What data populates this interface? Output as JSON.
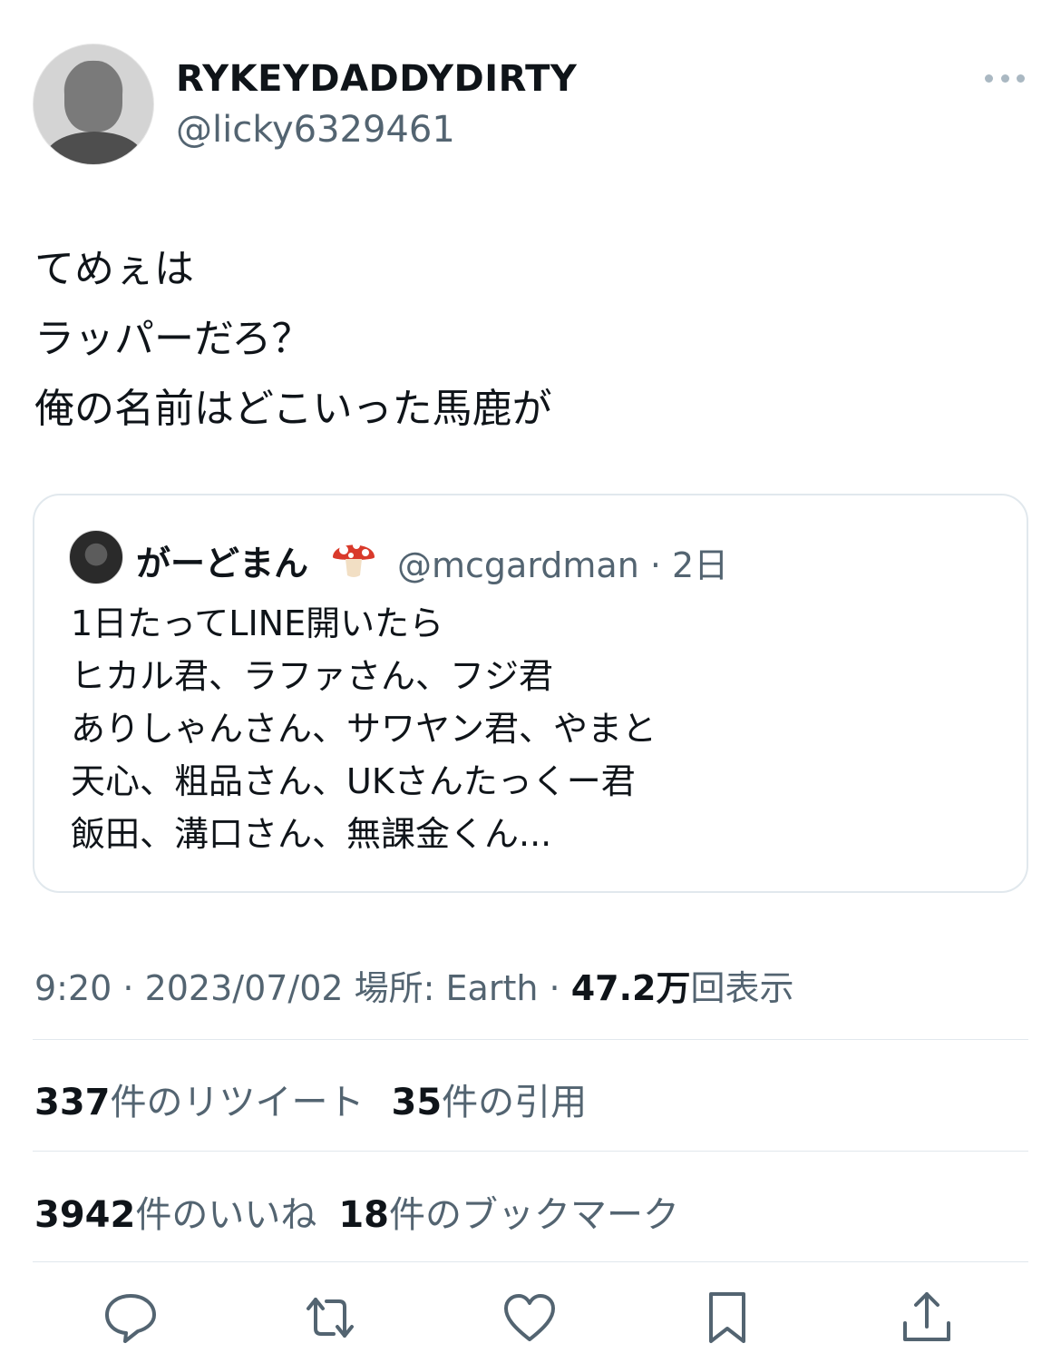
{
  "author": {
    "name": "RYKEYDADDYDIRTY",
    "handle": "@licky6329461"
  },
  "tweet": {
    "text": "てめぇは\nラッパーだろ？\n俺の名前はどこいった馬鹿が"
  },
  "quoted_tweet": {
    "name": "がーどまん",
    "emoji_icon": "mushroom-icon",
    "handle_time": "@mcgardman · 2日",
    "text": "1日たってLINE開いたら\nヒカル君、ラファさん、フジ君\nありしゃんさん、サワヤン君、やまと\n天心、粗品さん、UKさんたっくー君\n飯田、溝口さん、無課金くん..."
  },
  "meta": {
    "datetime_location": "9:20 · 2023/07/02 場所: Earth · ",
    "views_count": "47.2万",
    "views_label": "回表示"
  },
  "stats": {
    "retweets_count": "337",
    "retweets_label": "件のリツイート",
    "quotes_count": "35",
    "quotes_label": "件の引用",
    "likes_count": "3942",
    "likes_label": "件のいいね",
    "bookmarks_count": "18",
    "bookmarks_label": "件のブックマーク"
  },
  "actions": [
    "reply-icon",
    "retweet-icon",
    "like-icon",
    "bookmark-icon",
    "share-icon"
  ],
  "colors": {
    "secondary_text": "#536471",
    "divider": "#e1e8ed",
    "icon": "#536471"
  }
}
